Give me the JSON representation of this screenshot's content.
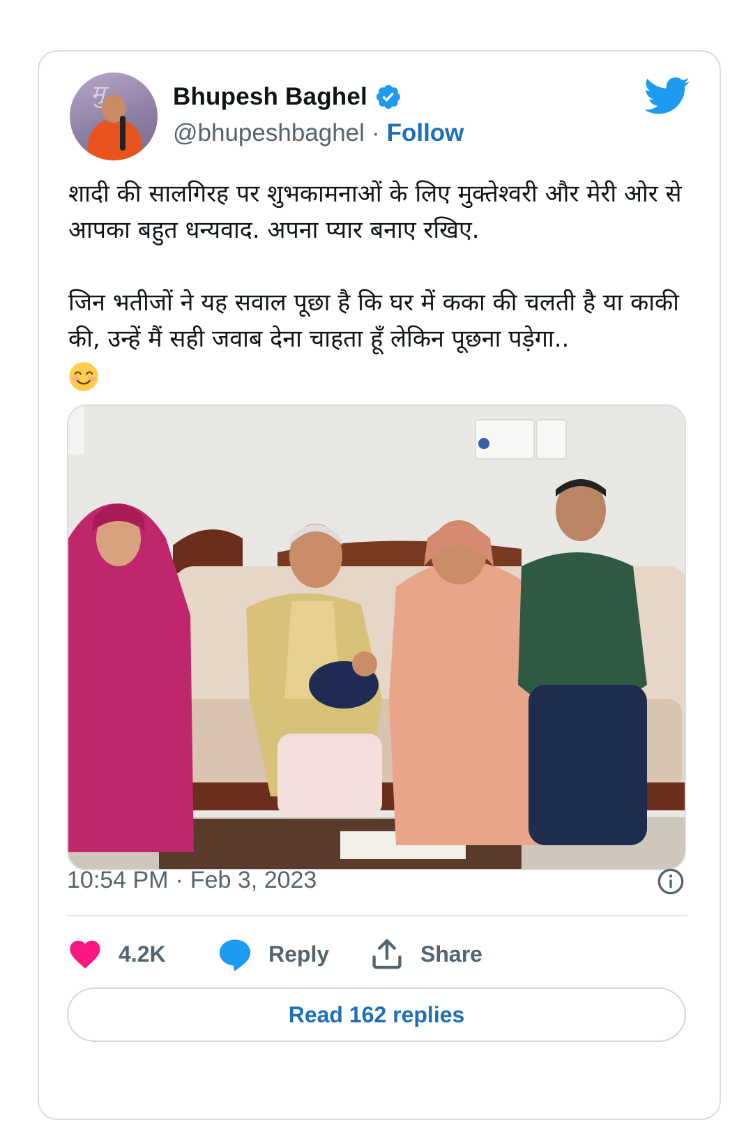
{
  "author": {
    "name": "Bhupesh Baghel",
    "handle": "@bhupeshbaghel",
    "separator": "·",
    "follow_label": "Follow"
  },
  "tweet": {
    "text": "शादी की सालगिरह पर शुभकामनाओं के लिए मुक्तेश्वरी और मेरी ओर से आपका बहुत धन्यवाद. अपना प्यार बनाए रखिए.\n\nजिन भतीजों ने यह सवाल पूछा है कि घर में कका की चलती है या काकी की, उन्हें मैं सही जवाब देना चाहता हूँ लेकिन पूछना पड़ेगा..",
    "emoji_name": "smiling-face-with-smiling-eyes"
  },
  "meta": {
    "time": "10:54 PM",
    "separator": "·",
    "date": "Feb 3, 2023"
  },
  "actions": {
    "likes": "4.2K",
    "reply_label": "Reply",
    "share_label": "Share"
  },
  "read_replies_label": "Read 162 replies",
  "colors": {
    "accent": "#1d9bf0",
    "link": "#1d6fb8",
    "like": "#f91880",
    "secondary_text": "#536471",
    "border": "#d9dde1"
  }
}
